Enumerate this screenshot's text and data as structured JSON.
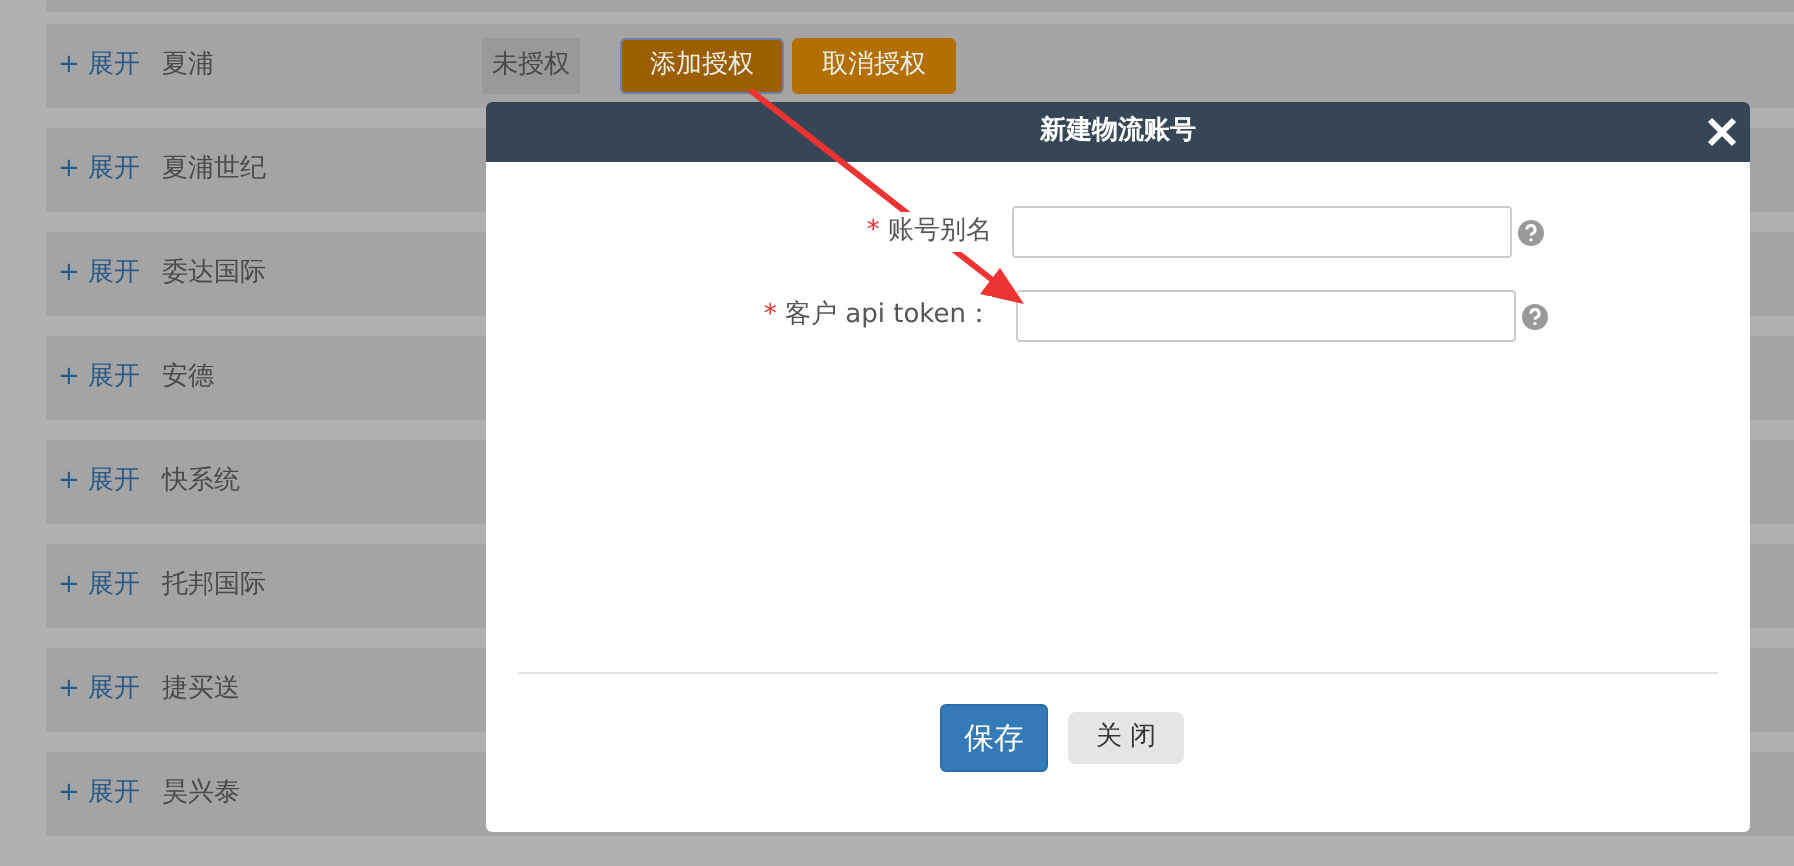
{
  "rows": [
    {
      "toggle": "+ 展开",
      "name": "夏浦",
      "status": "未授权",
      "actions": [
        {
          "label": "添加授权",
          "focused": true
        },
        {
          "label": "取消授权",
          "focused": false
        }
      ]
    },
    {
      "toggle": "+ 展开",
      "name": "夏浦世纪"
    },
    {
      "toggle": "+ 展开",
      "name": "委达国际"
    },
    {
      "toggle": "+ 展开",
      "name": "安德"
    },
    {
      "toggle": "+ 展开",
      "name": "快系统"
    },
    {
      "toggle": "+ 展开",
      "name": "托邦国际"
    },
    {
      "toggle": "+ 展开",
      "name": "捷买送"
    },
    {
      "toggle": "+ 展开",
      "name": "昊兴泰"
    }
  ],
  "dialog": {
    "title": "新建物流账号",
    "fields": [
      {
        "marker": "*",
        "label": "账号别名"
      },
      {
        "marker": "*",
        "label": "客户 api token："
      }
    ],
    "buttons": [
      {
        "label": "保存",
        "kind": "primary"
      },
      {
        "label": "关 闭",
        "kind": "secondary"
      }
    ]
  }
}
